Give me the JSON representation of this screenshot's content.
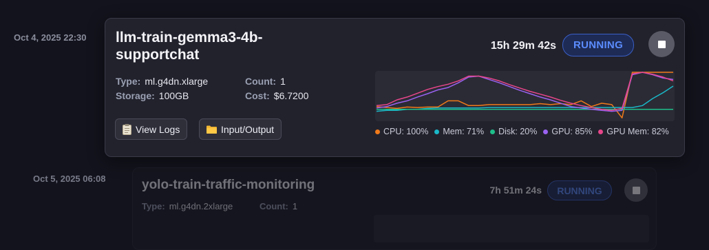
{
  "jobs": [
    {
      "timestamp": "Oct 4, 2025 22:30",
      "title": "llm-train-gemma3-4b-supportchat",
      "elapsed": "15h 29m 42s",
      "status": "RUNNING",
      "type_label": "Type:",
      "type_value": "ml.g4dn.xlarge",
      "count_label": "Count:",
      "count_value": "1",
      "storage_label": "Storage:",
      "storage_value": "100GB",
      "cost_label": "Cost:",
      "cost_value": "$6.7200",
      "view_logs_label": "View Logs",
      "io_label": "Input/Output",
      "legend": [
        {
          "label": "CPU: 100%",
          "color": "#f07a1a"
        },
        {
          "label": "Mem: 71%",
          "color": "#1ab8c8"
        },
        {
          "label": "Disk: 20%",
          "color": "#1fbf8a"
        },
        {
          "label": "GPU: 85%",
          "color": "#9a62f0"
        },
        {
          "label": "GPU Mem: 82%",
          "color": "#e8468a"
        }
      ]
    },
    {
      "timestamp": "Oct 5, 2025 06:08",
      "title": "yolo-train-traffic-monitoring",
      "elapsed": "7h 51m 24s",
      "status": "RUNNING",
      "type_label": "Type:",
      "type_value": "ml.g4dn.2xlarge",
      "count_label": "Count:",
      "count_value": "1"
    }
  ],
  "chart_data": {
    "type": "line",
    "x": [
      0,
      1,
      2,
      3,
      4,
      5,
      6,
      7,
      8,
      9,
      10,
      11,
      12,
      13,
      14,
      15,
      16,
      17,
      18,
      19,
      20,
      21,
      22,
      23,
      24,
      25,
      26,
      27,
      28,
      29
    ],
    "ylim": [
      0,
      100
    ],
    "colors": {
      "CPU": "#f07a1a",
      "Mem": "#1ab8c8",
      "Disk": "#1fbf8a",
      "GPU": "#9a62f0",
      "GPU Mem": "#e8468a"
    },
    "series": [
      {
        "name": "CPU",
        "values": [
          28,
          26,
          24,
          27,
          26,
          27,
          27,
          40,
          40,
          30,
          30,
          32,
          32,
          32,
          32,
          32,
          34,
          32,
          34,
          32,
          40,
          28,
          35,
          32,
          4,
          100,
          100,
          100,
          100,
          100
        ]
      },
      {
        "name": "Mem",
        "values": [
          18,
          20,
          20,
          22,
          22,
          24,
          25,
          25,
          25,
          25,
          25,
          26,
          26,
          26,
          26,
          26,
          26,
          26,
          26,
          26,
          26,
          26,
          26,
          26,
          26,
          26,
          30,
          45,
          57,
          71
        ]
      },
      {
        "name": "Disk",
        "values": [
          22,
          22,
          22,
          22,
          22,
          22,
          22,
          22,
          22,
          22,
          22,
          22,
          22,
          22,
          22,
          22,
          22,
          22,
          22,
          22,
          22,
          22,
          22,
          22,
          22,
          22,
          22,
          22,
          22,
          22
        ]
      },
      {
        "name": "GPU",
        "values": [
          25,
          28,
          35,
          40,
          48,
          55,
          63,
          68,
          78,
          90,
          92,
          85,
          78,
          70,
          62,
          55,
          48,
          42,
          35,
          28,
          25,
          22,
          20,
          18,
          20,
          95,
          100,
          95,
          88,
          85
        ]
      },
      {
        "name": "GPU Mem",
        "values": [
          30,
          32,
          42,
          48,
          56,
          64,
          70,
          75,
          82,
          92,
          92,
          88,
          82,
          74,
          67,
          60,
          54,
          48,
          41,
          35,
          30,
          26,
          22,
          20,
          24,
          97,
          100,
          96,
          90,
          82
        ]
      }
    ]
  }
}
